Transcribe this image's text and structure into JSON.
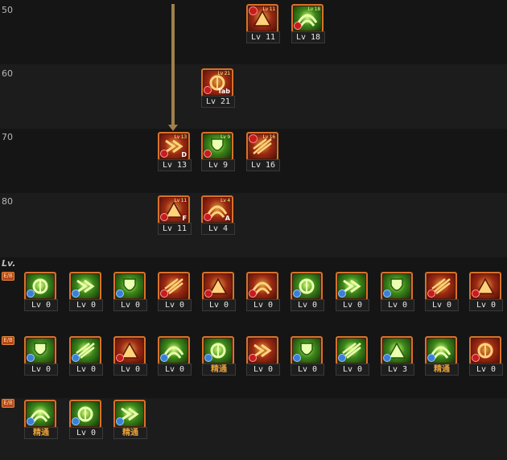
{
  "tree_rows": [
    {
      "label": "50"
    },
    {
      "label": "60"
    },
    {
      "label": "70"
    },
    {
      "label": "80"
    }
  ],
  "section": {
    "header": "Lv.",
    "row_tag": "E/B"
  },
  "tree_skills": [
    {
      "level_text": "Lv 11",
      "style": "red",
      "tiny": "Lv 11",
      "badge": "lock"
    },
    {
      "level_text": "Lv 18",
      "style": "green",
      "tiny": "Lv 18",
      "badge": "warn"
    },
    {
      "level_text": "Lv 21",
      "style": "red",
      "tiny": "Lv 21",
      "key": "Tab",
      "badge": "warn"
    },
    {
      "level_text": "Lv 13",
      "style": "red",
      "tiny": "Lv 13",
      "key": "D",
      "badge": "warn"
    },
    {
      "level_text": "Lv 9",
      "style": "green",
      "tiny": "Lv 9",
      "badge": "warn"
    },
    {
      "level_text": "Lv 16",
      "style": "red",
      "tiny": "Lv 16",
      "badge": "lock"
    },
    {
      "level_text": "Lv 11",
      "style": "red",
      "tiny": "Lv 11",
      "key": "F",
      "badge": "warn"
    },
    {
      "level_text": "Lv 4",
      "style": "red",
      "tiny": "Lv 4",
      "key": "A",
      "badge": "warn"
    }
  ],
  "row1": [
    {
      "level_text": "Lv 0",
      "style": "green",
      "badge": "gear"
    },
    {
      "level_text": "Lv 0",
      "style": "green",
      "badge": "gear"
    },
    {
      "level_text": "Lv 0",
      "style": "green",
      "badge": "gear"
    },
    {
      "level_text": "Lv 0",
      "style": "red",
      "badge": "warn"
    },
    {
      "level_text": "Lv 0",
      "style": "red",
      "badge": "warn"
    },
    {
      "level_text": "Lv 0",
      "style": "red",
      "badge": "warn"
    },
    {
      "level_text": "Lv 0",
      "style": "green",
      "badge": "gear"
    },
    {
      "level_text": "Lv 0",
      "style": "green",
      "badge": "gear"
    },
    {
      "level_text": "Lv 0",
      "style": "green",
      "badge": "gear"
    },
    {
      "level_text": "Lv 0",
      "style": "red",
      "badge": "warn"
    },
    {
      "level_text": "Lv 0",
      "style": "red",
      "badge": "warn"
    }
  ],
  "row2": [
    {
      "level_text": "Lv 0",
      "style": "green",
      "badge": "gear"
    },
    {
      "level_text": "Lv 0",
      "style": "green",
      "badge": "gear"
    },
    {
      "level_text": "Lv 0",
      "style": "red",
      "badge": "warn"
    },
    {
      "level_text": "Lv 0",
      "style": "green",
      "badge": "gear"
    },
    {
      "level_text": "精通",
      "style": "green",
      "badge": "gear",
      "master": true
    },
    {
      "level_text": "Lv 0",
      "style": "red",
      "badge": "warn"
    },
    {
      "level_text": "Lv 0",
      "style": "green",
      "badge": "gear"
    },
    {
      "level_text": "Lv 0",
      "style": "green",
      "badge": "gear"
    },
    {
      "level_text": "Lv 3",
      "style": "green",
      "badge": "gear"
    },
    {
      "level_text": "精通",
      "style": "green",
      "badge": "gear",
      "master": true
    },
    {
      "level_text": "Lv 0",
      "style": "red",
      "badge": "warn"
    }
  ],
  "row3": [
    {
      "level_text": "精通",
      "style": "green",
      "badge": "gear",
      "master": true
    },
    {
      "level_text": "Lv 0",
      "style": "green",
      "badge": "gear"
    },
    {
      "level_text": "精通",
      "style": "green",
      "badge": "gear",
      "master": true
    }
  ]
}
